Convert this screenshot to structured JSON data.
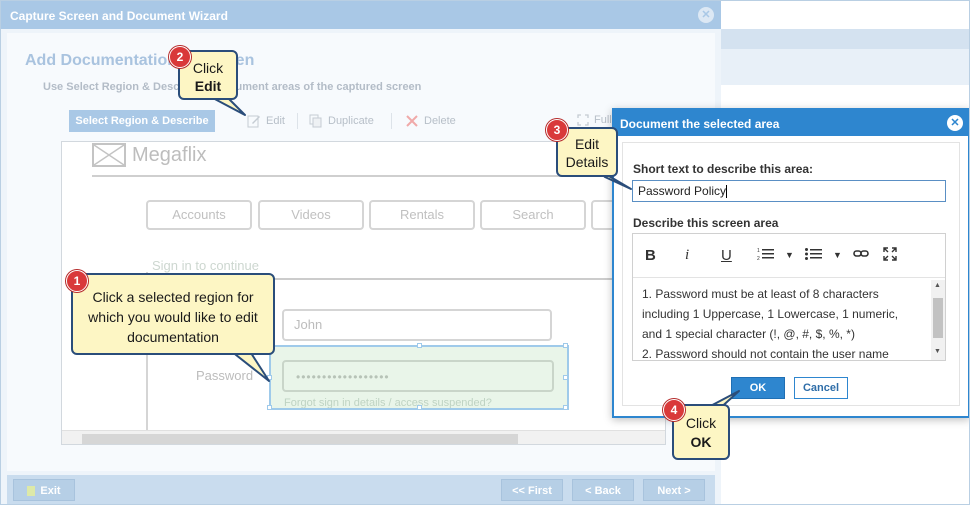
{
  "wizard": {
    "title": "Capture Screen and Document Wizard",
    "page_title": "Add Documentation to Screen",
    "subtitle": "Use Select Region & Describe to document areas of the captured screen",
    "toolbar": {
      "select_region": "Select Region & Describe",
      "edit": "Edit",
      "duplicate": "Duplicate",
      "delete": "Delete",
      "full": "Full"
    },
    "footer": {
      "exit": "Exit",
      "first": "<< First",
      "back": "< Back",
      "next": "Next >"
    }
  },
  "canvas": {
    "logo": "Megaflix",
    "tabs": [
      "Accounts",
      "Videos",
      "Rentals",
      "Search"
    ],
    "signin": "Sign in to continue",
    "username_value": "John",
    "password_label": "Password",
    "password_mask": "••••••••••••••••••",
    "forgot": "Forgot sign in details / access suspended?"
  },
  "modal": {
    "title": "Document the selected area",
    "short_label": "Short text to describe this area:",
    "short_value": "Password Policy",
    "describe_label": "Describe this screen area",
    "content_lines": [
      "1. Password must be at least of 8 characters",
      "including 1 Uppercase, 1 Lowercase, 1 numeric,",
      "and 1 special character (!, @, #, $, %, *)",
      "2. Password should not contain the user name"
    ],
    "ok": "OK",
    "cancel": "Cancel"
  },
  "callouts": {
    "c1": {
      "num": "1",
      "text": "Click a selected region for which you would like to edit documentation"
    },
    "c2": {
      "num": "2",
      "line1": "Click",
      "line2": "Edit"
    },
    "c3": {
      "num": "3",
      "line1": "Edit",
      "line2": "Details"
    },
    "c4": {
      "num": "4",
      "line1": "Click",
      "line2": "OK"
    }
  },
  "colors": {
    "accent": "#2e86cf",
    "callout_bg": "#fdf6c4",
    "callout_border": "#2a4d7a",
    "badge": "#d9393a"
  }
}
